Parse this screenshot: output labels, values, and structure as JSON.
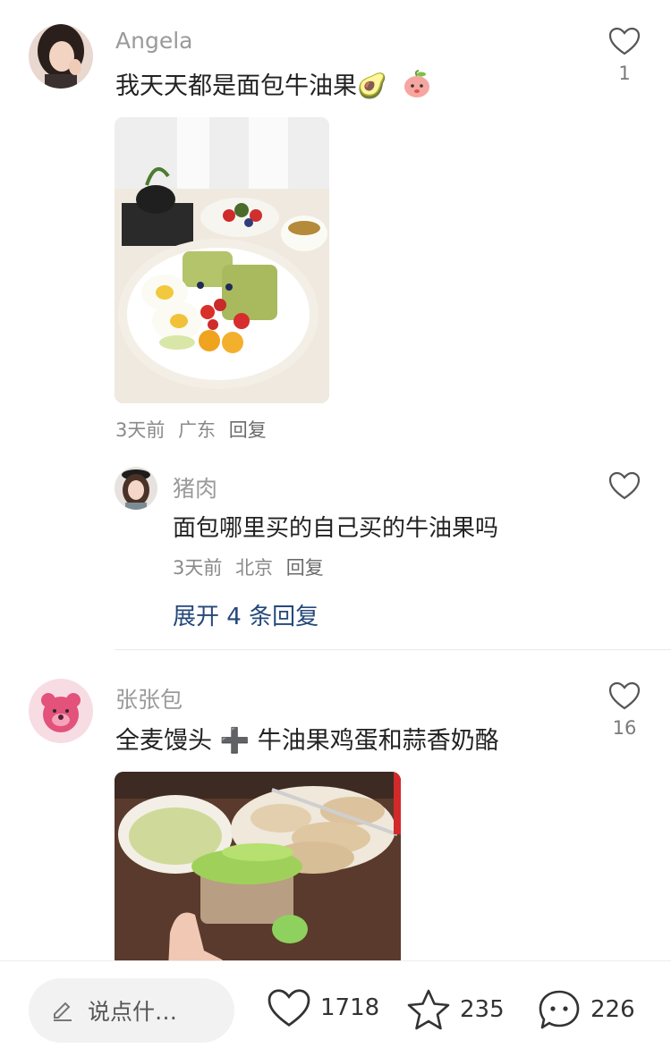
{
  "comments": [
    {
      "username": "Angela",
      "text": "我天天都是面包牛油果🥑",
      "like_count": "1",
      "meta": {
        "time": "3天前",
        "location": "广东",
        "reply": "回复"
      },
      "replies": [
        {
          "username": "猪肉",
          "text": "面包哪里买的自己买的牛油果吗",
          "meta": {
            "time": "3天前",
            "location": "北京",
            "reply": "回复"
          }
        }
      ],
      "expand_label": "展开 4 条回复"
    },
    {
      "username": "张张包",
      "text": "全麦馒头 ➕ 牛油果鸡蛋和蒜香奶酪",
      "like_count": "16"
    }
  ],
  "bottom_bar": {
    "input_placeholder": "说点什…",
    "likes": "1718",
    "stars": "235",
    "comments": "226"
  },
  "icons": {
    "like": "heart-outline-icon",
    "star": "star-outline-icon",
    "comment": "chat-bubble-icon",
    "pencil": "pencil-icon"
  }
}
